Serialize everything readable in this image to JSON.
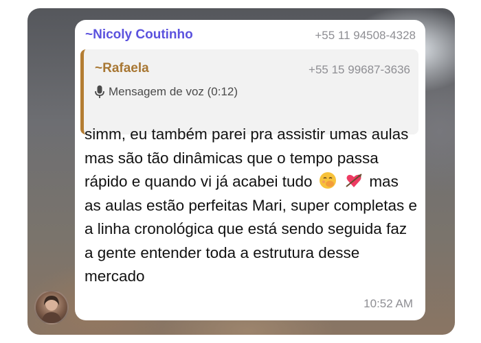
{
  "message": {
    "sender_name": "~Nicoly Coutinho",
    "sender_phone": "+55 11 94508-4328",
    "quoted": {
      "sender_name": "~Rafaela",
      "sender_phone": "+55 15 99687-3636",
      "content": "Mensagem de voz (0:12)",
      "icon": "mic-icon"
    },
    "text_part1": "simm, eu também parei pra assistir umas aulas mas são tão dinâmicas que o tempo passa rápido e quando vi já acabei tudo",
    "text_part2": "mas as aulas estão perfeitas Mari, super completas e a linha cronológica que está sendo seguida faz a gente entender toda a estrutura desse mercado",
    "emojis": [
      "hand-over-mouth-emoji",
      "heart-with-arrow-emoji"
    ],
    "time": "10:52 AM"
  },
  "colors": {
    "sender": "#5b52de",
    "quoted_sender": "#a87733",
    "quote_bar": "#b47d33"
  }
}
